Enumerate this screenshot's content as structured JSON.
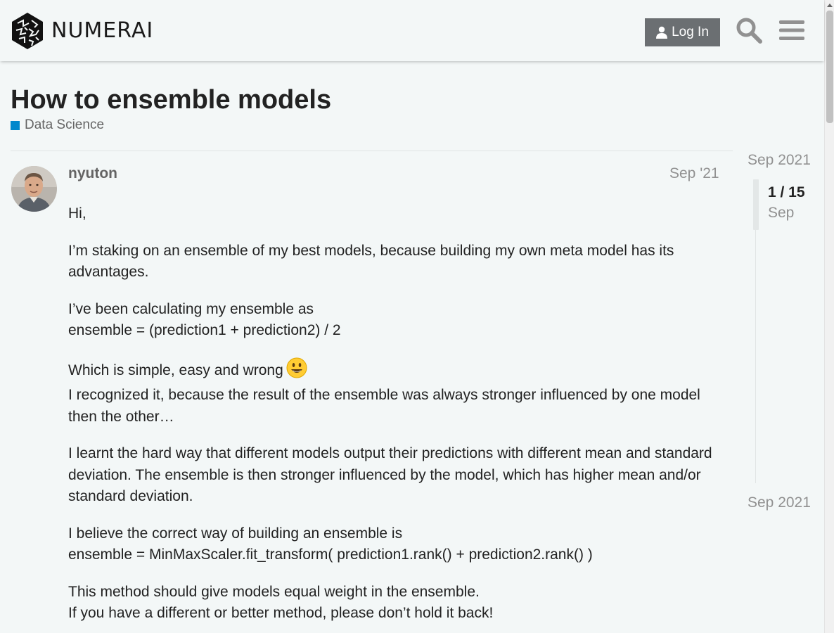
{
  "header": {
    "brand": "NUMERAI",
    "login_label": "Log In",
    "search_icon": "search-icon",
    "menu_icon": "hamburger-menu-icon"
  },
  "topic": {
    "title": "How to ensemble models",
    "category": {
      "label": "Data Science",
      "color": "#0088cc"
    }
  },
  "post": {
    "username": "nyuton",
    "date": "Sep '21",
    "paragraphs": {
      "p1": "Hi,",
      "p2": "I’m staking on an ensemble of my best models, because building my own meta model has its advantages.",
      "p3_line1": "I’ve been calculating my ensemble as",
      "p3_line2": "ensemble = (prediction1 + prediction2) / 2",
      "p4_line1": "Which is simple, easy and wrong",
      "p4_line2": "I recognized it, because the result of the ensemble was always stronger influenced by one model then the other…",
      "p5": "I learnt the hard way that different models output their predictions with different mean and standard deviation. The ensemble is then stronger influenced by the model, which has higher mean and/or standard deviation.",
      "p6_line1": "I believe the correct way of building an ensemble is",
      "p6_line2": "ensemble = MinMaxScaler.fit_transform( prediction1.rank() + prediction2.rank() )",
      "p7_line1": "This method should give models equal weight in the ensemble.",
      "p7_line2": "If you have a different or better method, please don’t hold it back!"
    },
    "emoji": "smiley-emoji"
  },
  "timeline": {
    "start_date": "Sep 2021",
    "position": "1 / 15",
    "month": "Sep",
    "end_date": "Sep 2021"
  }
}
